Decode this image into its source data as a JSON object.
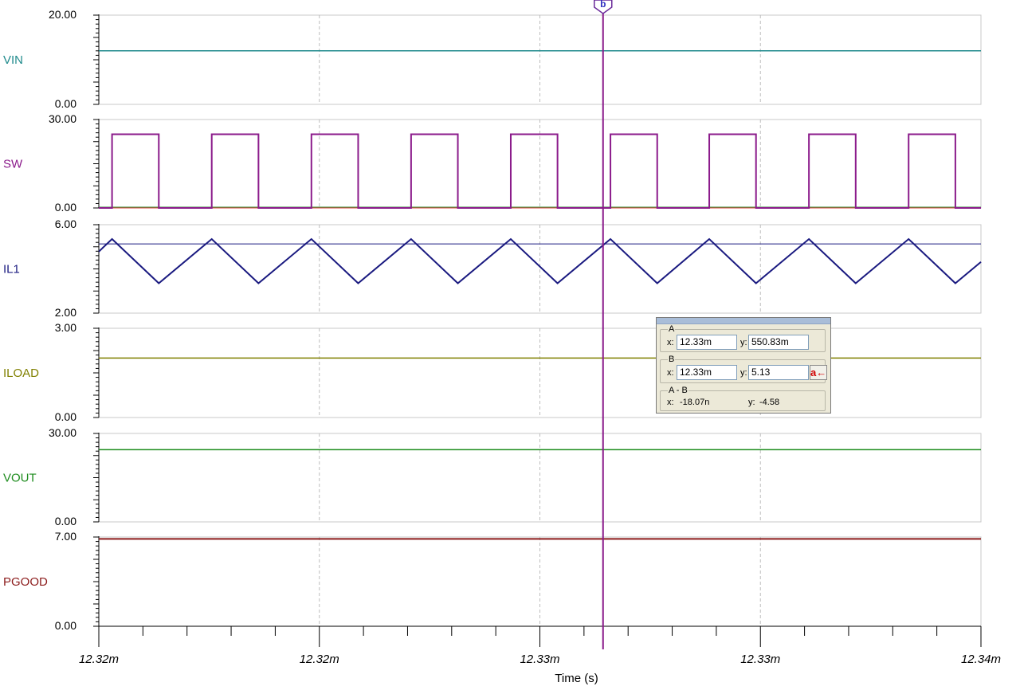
{
  "chart_data": {
    "type": "line",
    "xlabel": "Time (s)",
    "x_ticks": [
      "12.32m",
      "12.32m",
      "12.33m",
      "12.33m",
      "12.34m"
    ],
    "cursor_marker": "b",
    "panels": [
      {
        "name": "VIN",
        "color": "#1f8a8c",
        "y_max_label": "20.00",
        "y_min_label": "0.00",
        "ylim": [
          0,
          20
        ],
        "shape": "flat",
        "level": 12
      },
      {
        "name": "SW",
        "color": "#8b1b8b",
        "y_max_label": "30.00",
        "y_min_label": "0.00",
        "ylim": [
          0,
          30
        ],
        "shape": "square",
        "high": 25,
        "low": 0,
        "pulses": [
          [
            0.015,
            0.068
          ],
          [
            0.128,
            0.181
          ],
          [
            0.241,
            0.294
          ],
          [
            0.354,
            0.407
          ],
          [
            0.467,
            0.52
          ],
          [
            0.58,
            0.633
          ],
          [
            0.692,
            0.745
          ],
          [
            0.805,
            0.858
          ],
          [
            0.918,
            0.971
          ]
        ]
      },
      {
        "name": "IL1",
        "color": "#1a1a80",
        "y_max_label": "6.00",
        "y_min_label": "2.00",
        "ylim": [
          2,
          6
        ],
        "shape": "triangle",
        "peak": 5.35,
        "valley": 3.35,
        "ref_level": 5.13,
        "peaks": [
          0.015,
          0.128,
          0.241,
          0.354,
          0.467,
          0.58,
          0.692,
          0.805,
          0.918
        ],
        "valleys": [
          0.068,
          0.181,
          0.294,
          0.407,
          0.52,
          0.633,
          0.745,
          0.858,
          0.971
        ]
      },
      {
        "name": "ILOAD",
        "color": "#808000",
        "y_max_label": "3.00",
        "y_min_label": "0.00",
        "ylim": [
          0,
          3
        ],
        "shape": "flat",
        "level": 2.0
      },
      {
        "name": "VOUT",
        "color": "#1e8c1e",
        "y_max_label": "30.00",
        "y_min_label": "0.00",
        "ylim": [
          0,
          30
        ],
        "shape": "flat",
        "level": 24.5
      },
      {
        "name": "PGOOD",
        "color": "#8b1a1a",
        "y_max_label": "7.00",
        "y_min_label": "0.00",
        "ylim": [
          0,
          7
        ],
        "shape": "flat",
        "level": 6.85
      }
    ]
  },
  "cursor_panel": {
    "a_label": "A",
    "a_x_label": "x:",
    "a_x_value": "12.33m",
    "a_y_label": "y:",
    "a_y_value": "550.83m",
    "b_label": "B",
    "b_x_label": "x:",
    "b_x_value": "12.33m",
    "b_y_label": "y:",
    "b_y_value": "5.13",
    "snap_label": "a←",
    "diff_label": "A - B",
    "diff_x_label": "x:",
    "diff_x_value": "-18.07n",
    "diff_y_label": "y:",
    "diff_y_value": "-4.58"
  }
}
